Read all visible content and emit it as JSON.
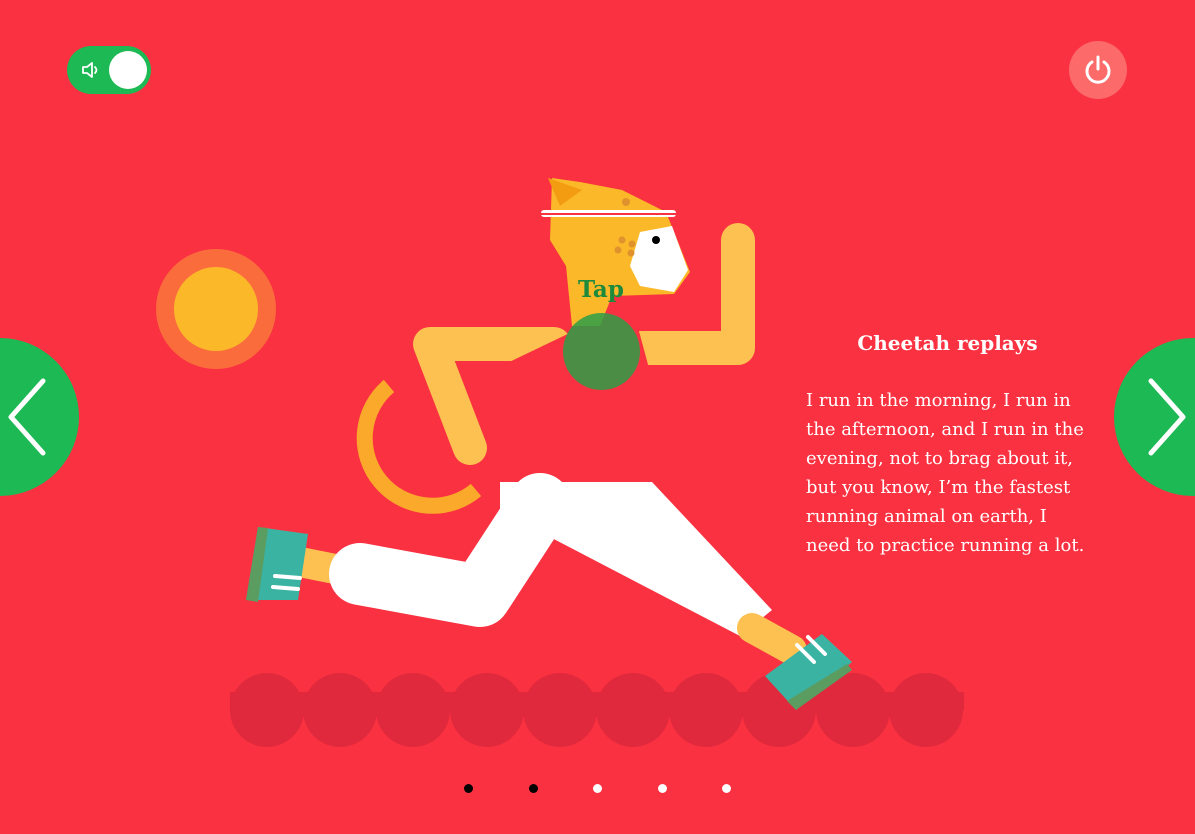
{
  "colors": {
    "background": "#fa3140",
    "accent_green": "#1db954",
    "dot_active": "#000000",
    "dot_inactive": "#ffffff"
  },
  "controls": {
    "sound_icon": "speaker-icon",
    "power_icon": "power-icon",
    "prev_icon": "chevron-left-icon",
    "next_icon": "chevron-right-icon"
  },
  "scene": {
    "tap_label": "Tap"
  },
  "story": {
    "title": "Cheetah replays",
    "text": "I run in the morning, I run in the afternoon, and I run in the evening, not to brag about it, but you know, I’m the fastest running animal on earth, I need to practice running a lot."
  },
  "pagination": {
    "count": 5,
    "dots": [
      "active",
      "active",
      "inactive",
      "inactive",
      "inactive"
    ]
  }
}
